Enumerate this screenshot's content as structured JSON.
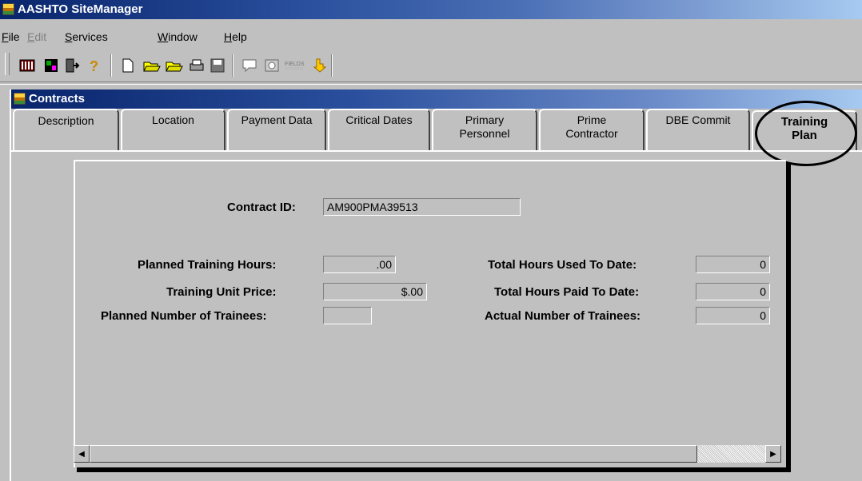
{
  "app": {
    "title": "AASHTO SiteManager"
  },
  "menubar": {
    "items": [
      {
        "label": "File",
        "accel": "F",
        "rest": "ile",
        "enabled": true
      },
      {
        "label": "Edit",
        "accel": "E",
        "rest": "dit",
        "enabled": false
      },
      {
        "label": "Services",
        "accel": "S",
        "rest": "ervices",
        "enabled": true
      },
      {
        "label": "Window",
        "accel": "W",
        "rest": "indow",
        "enabled": true
      },
      {
        "label": "Help",
        "accel": "H",
        "rest": "elp",
        "enabled": true
      }
    ]
  },
  "toolbar": {
    "icons": [
      "calculator-icon",
      "tools-icon",
      "exit-door-icon",
      "help-icon",
      "new-document-icon",
      "open-folder-icon",
      "open-folder-2-icon",
      "print-icon",
      "save-icon",
      "comment-icon",
      "browse-icon",
      "fields-icon",
      "pointer-icon"
    ]
  },
  "window": {
    "title": "Contracts"
  },
  "tabs": [
    {
      "label": "Description"
    },
    {
      "label": "Location"
    },
    {
      "label": "Payment Data"
    },
    {
      "label": "Critical Dates"
    },
    {
      "label": "Primary Personnel",
      "line1": "Primary",
      "line2": "Personnel"
    },
    {
      "label": "Prime Contractor",
      "line1": "Prime",
      "line2": "Contractor"
    },
    {
      "label": "DBE Commit"
    },
    {
      "label": "Training Plan",
      "line1": "Training",
      "line2": "Plan",
      "active": true
    }
  ],
  "form": {
    "contract_id": {
      "label": "Contract ID:",
      "value": "AM900PMA39513"
    },
    "planned_training_hours": {
      "label": "Planned Training Hours:",
      "value": ".00"
    },
    "training_unit_price": {
      "label": "Training Unit Price:",
      "value": "$.00"
    },
    "planned_number_of_trainees": {
      "label": "Planned Number of Trainees:",
      "value": ""
    },
    "total_hours_used_to_date": {
      "label": "Total Hours Used To Date:",
      "value": "0"
    },
    "total_hours_paid_to_date": {
      "label": "Total Hours Paid To Date:",
      "value": "0"
    },
    "actual_number_of_trainees": {
      "label": "Actual Number of Trainees:",
      "value": "0"
    }
  },
  "colors": {
    "titlebar_start": "#08246b",
    "titlebar_end": "#a6caf0",
    "face": "#c0c0c0"
  }
}
